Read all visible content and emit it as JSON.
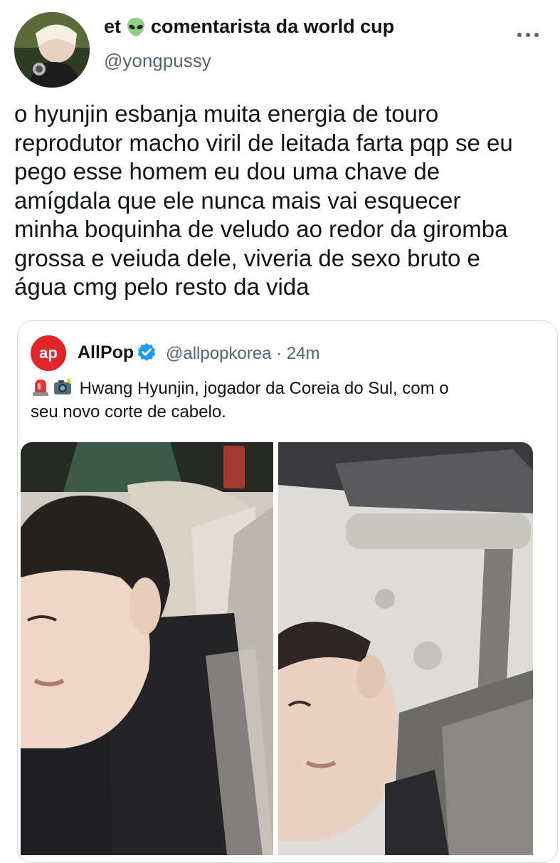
{
  "author": {
    "display_name_before": "et",
    "display_name_after": "comentarista da world cup",
    "handle": "@yongpussy",
    "avatar_icon": "avatar",
    "more_icon": "more-options-icon"
  },
  "tweet": {
    "lines": [
      "o hyunjin esbanja muita energia de touro",
      "reprodutor macho viril de leitada farta pqp se eu",
      "pego esse homem eu dou uma chave de",
      "amígdala que ele nunca mais vai esquecer",
      "minha boquinha de veludo ao redor da giromba",
      "grossa e veiuda dele, viveria de sexo bruto e",
      "água cmg pelo resto da vida"
    ]
  },
  "quote": {
    "name": "AllPop",
    "handle": "@allpopkorea",
    "separator": "·",
    "time": "24m",
    "logo_text": "ap",
    "text_line1": "Hwang Hyunjin, jogador da Coreia do Sul, com o",
    "text_line2": "seu novo corte de cabelo.",
    "colors": {
      "brand": "#e0262b",
      "verified": "#1d9bf0"
    }
  }
}
